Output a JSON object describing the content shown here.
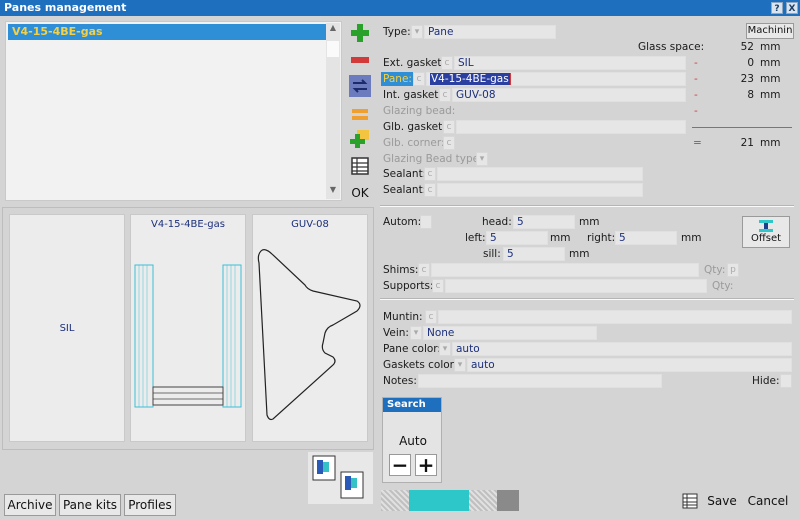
{
  "window": {
    "title": "Panes management",
    "help_btn": "?",
    "close_btn": "X"
  },
  "list": {
    "items": [
      {
        "label": "V4-15-4BE-gas"
      }
    ]
  },
  "side_buttons": {
    "ok": "OK"
  },
  "preview": {
    "left_label": "SIL",
    "mid_label": "V4-15-4BE-gas",
    "right_label": "GUV-08"
  },
  "bottom_tabs": {
    "archive": "Archive",
    "pane_kits": "Pane kits",
    "profiles": "Profiles"
  },
  "form": {
    "type_label": "Type:",
    "type_value": "Pane",
    "machining_label": "Machinin",
    "glass_space_label": "Glass space:",
    "glass_space_value": "52",
    "glass_space_unit": "mm",
    "ext_gasket_label": "Ext. gasket:",
    "ext_gasket_value": "SIL",
    "ext_gasket_dim": "0",
    "ext_gasket_unit": "mm",
    "pane_label": "Pane:",
    "pane_value": "V4-15-4BE-gas",
    "pane_dim": "23",
    "pane_unit": "mm",
    "int_gasket_label": "Int. gasket:",
    "int_gasket_value": "GUV-08",
    "int_gasket_dim": "8",
    "int_gasket_unit": "mm",
    "glazing_bead_label": "Glazing bead:",
    "glb_gasket_label": "Glb. gasket:",
    "glb_corner_label": "Glb. corner:",
    "glb_corner_dim": "21",
    "glb_corner_unit": "mm",
    "glazing_bead_type_label": "Glazing Bead type:",
    "sealant1_label": "Sealant:",
    "sealant2_label": "Sealant:",
    "minus_sign": "-",
    "equals_sign": "=",
    "autom_label": "Autom:",
    "head_label": "head:",
    "head_value": "5",
    "head_unit": "mm",
    "left_label": "left:",
    "left_value": "5",
    "left_unit": "mm",
    "right_label": "right:",
    "right_value": "5",
    "right_unit": "mm",
    "sill_label": "sill:",
    "sill_value": "5",
    "sill_unit": "mm",
    "offset_label": "Offset",
    "shims_label": "Shims:",
    "qty_label": "Qty:",
    "supports_label": "Supports:",
    "qty2_label": "Qty:",
    "muntin_label": "Muntin:",
    "vein_label": "Vein:",
    "vein_value": "None",
    "pane_color_label": "Pane color:",
    "pane_color_value": "auto",
    "gaskets_color_label": "Gaskets color:",
    "gaskets_color_value": "auto",
    "notes_label": "Notes:",
    "hide_label": "Hide:"
  },
  "search": {
    "title": "Search",
    "auto": "Auto",
    "minus": "−",
    "plus": "+"
  },
  "actions": {
    "save": "Save",
    "cancel": "Cancel"
  },
  "colors": {
    "titlebar": "#1f6fbf",
    "selection": "#2f8fd6",
    "accent_cyan": "#2ec7c9",
    "highlight_yellow": "#f2d04a"
  }
}
